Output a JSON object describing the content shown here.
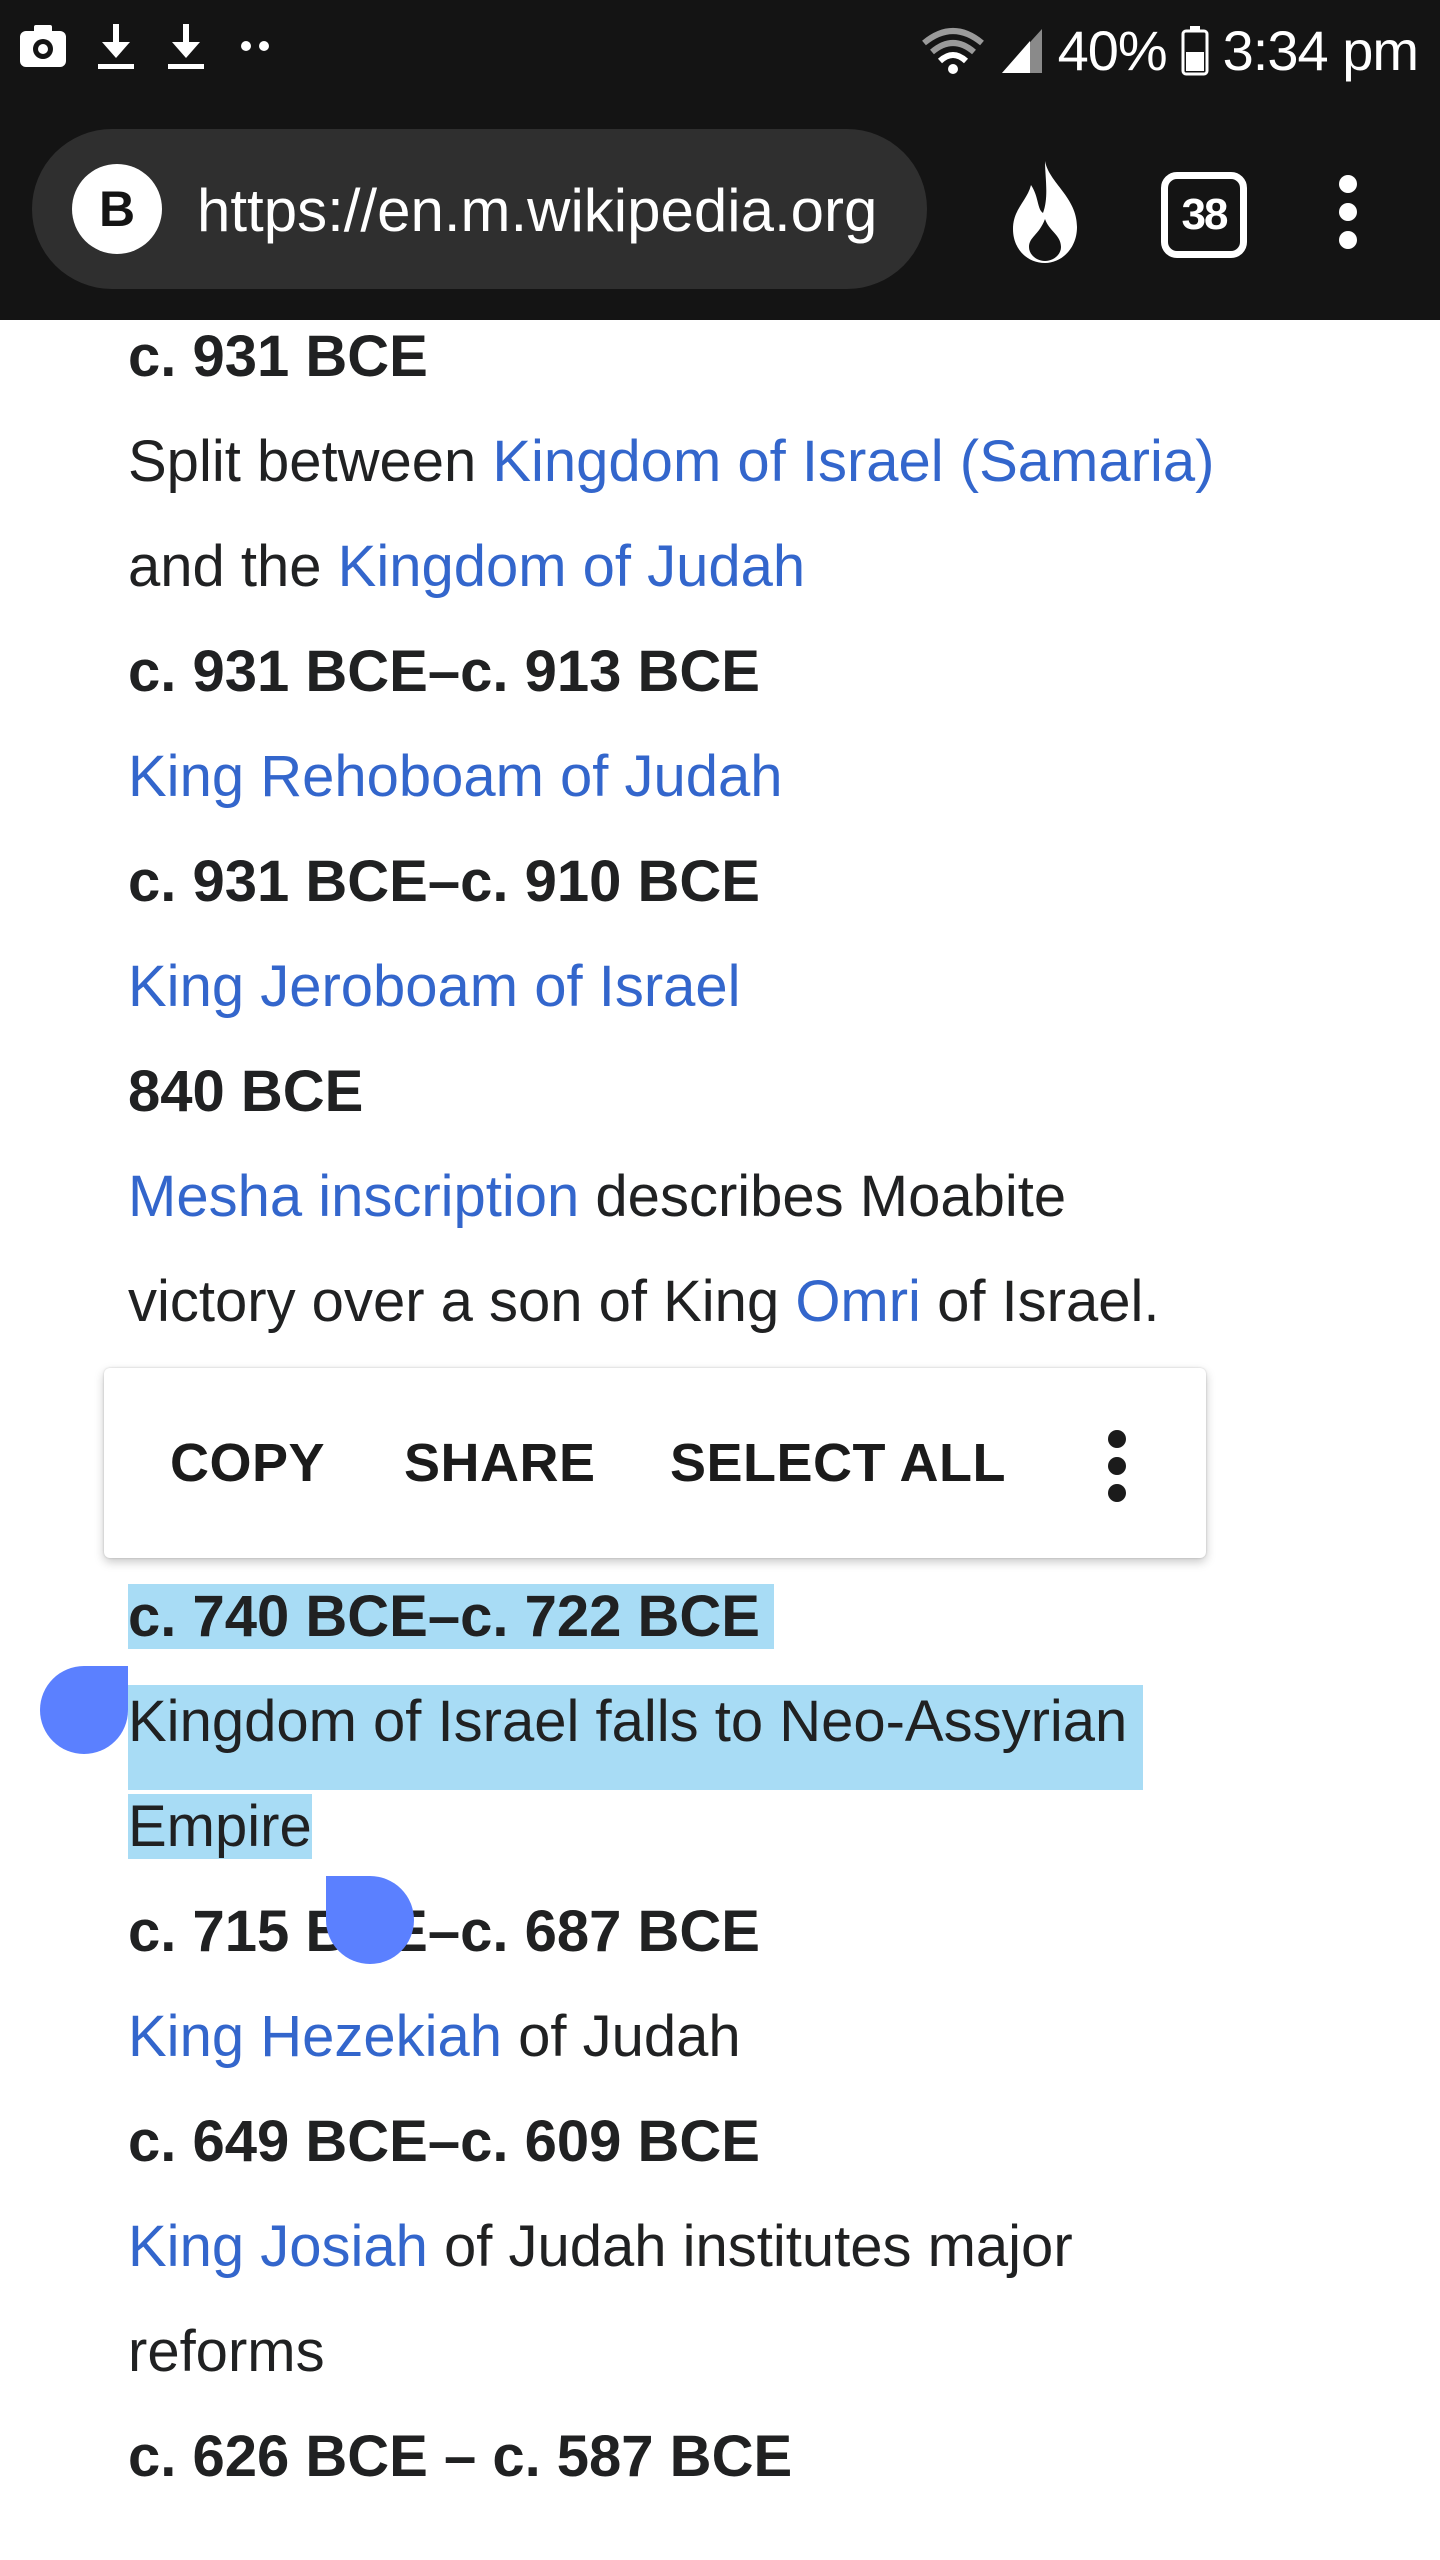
{
  "status_bar": {
    "left_icons": [
      "screenshot-icon",
      "download-icon",
      "download-icon",
      "more-notifications-icon"
    ],
    "battery_percent": "40%",
    "time": "3:34 pm"
  },
  "browser": {
    "site_badge": "B",
    "url": "https://en.m.wikipedia.org",
    "tab_count": "38",
    "icons": [
      "fire-icon",
      "tabs-icon",
      "overflow-menu-icon"
    ]
  },
  "article": {
    "e1_date": "c. 931 BCE",
    "e1_text_a": "Split between ",
    "e1_link_a": "Kingdom of Israel (Samaria)",
    "e1_text_b": "and the ",
    "e1_link_b": "Kingdom of Judah",
    "e2_date": "c. 931 BCE–c. 913 BCE",
    "e2_link": "King Rehoboam of Judah",
    "e3_date": "c. 931 BCE–c. 910 BCE",
    "e3_link": "King Jeroboam of Israel",
    "e4_date": "840 BCE",
    "e4_link_a": "Mesha inscription",
    "e4_text_a": " describes Moabite",
    "e4_text_b": "victory over a son of King ",
    "e4_link_b": "Omri",
    "e4_text_c": " of Israel.",
    "e5_date": "c. 740 BCE–c. 722 BCE",
    "e5_text_a": "Kingdom of Israel falls to Neo-Assyrian",
    "e5_text_b": "Empire",
    "e6_date": "c. 715 BCE–c. 687 BCE",
    "e6_link": "King Hezekiah",
    "e6_text": " of Judah",
    "e7_date": "c. 649 BCE–c. 609 BCE",
    "e7_link": "King Josiah",
    "e7_text_a": " of Judah institutes major",
    "e7_text_b": "reforms",
    "e8_date": "c. 626 BCE – c. 587 BCE"
  },
  "context_menu": {
    "copy": "COPY",
    "share": "SHARE",
    "select_all": "SELECT ALL",
    "more_icon": "more-vert-icon"
  },
  "colors": {
    "link": "#3366cc",
    "selection": "#a8dcf5",
    "handle": "#5b80ff",
    "chrome": "#141414"
  }
}
